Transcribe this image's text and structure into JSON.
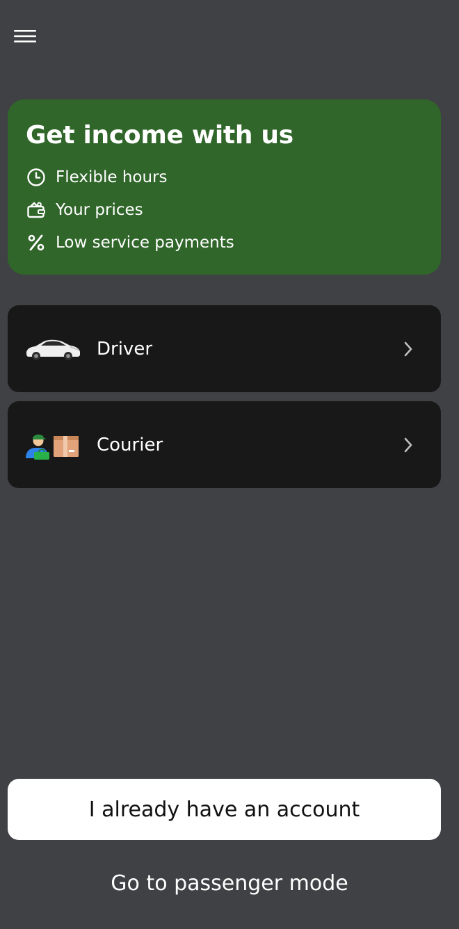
{
  "header": {
    "menu_icon": "hamburger-menu-icon"
  },
  "promo": {
    "title": "Get income with us",
    "bg_color": "#30662a",
    "features": [
      {
        "icon": "clock-icon",
        "label": "Flexible hours"
      },
      {
        "icon": "wallet-icon",
        "label": "Your prices"
      },
      {
        "icon": "percent-icon",
        "label": "Low service payments"
      }
    ]
  },
  "roles": [
    {
      "label": "Driver",
      "icon": "car-icon",
      "chevron": "chevron-right-icon"
    },
    {
      "label": "Courier",
      "icon": "courier-icon",
      "chevron": "chevron-right-icon"
    }
  ],
  "actions": {
    "account_label": "I already have an account",
    "passenger_label": "Go to passenger mode"
  }
}
